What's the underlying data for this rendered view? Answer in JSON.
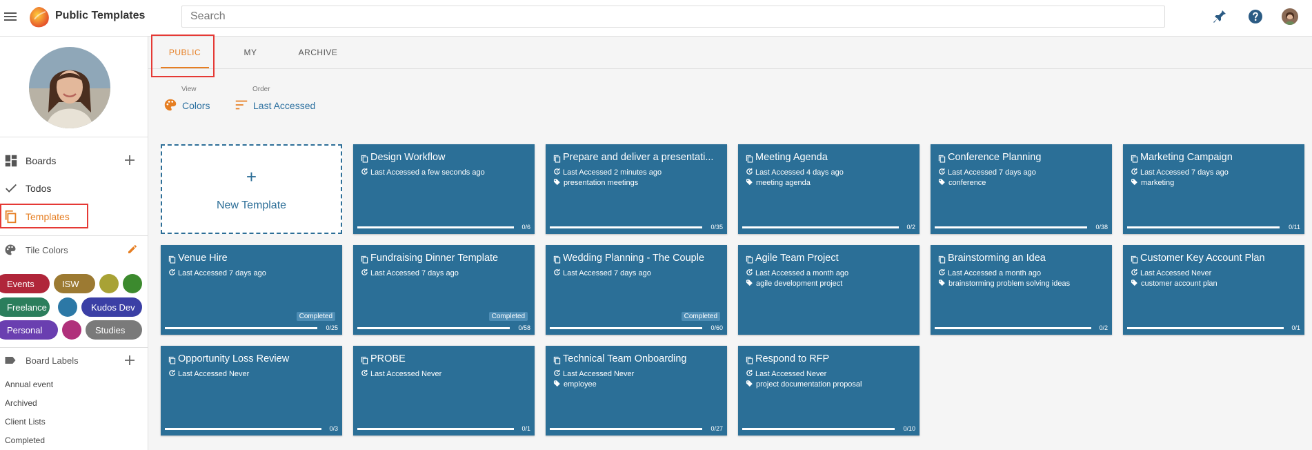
{
  "app": {
    "title": "Public Templates"
  },
  "search": {
    "placeholder": "Search",
    "value": ""
  },
  "tabs": [
    {
      "label": "PUBLIC",
      "active": true
    },
    {
      "label": "MY",
      "active": false
    },
    {
      "label": "ARCHIVE",
      "active": false
    }
  ],
  "view": {
    "label": "View",
    "value": "Colors"
  },
  "order": {
    "label": "Order",
    "value": "Last Accessed"
  },
  "sidebar": {
    "nav": [
      {
        "label": "Boards",
        "icon": "dashboard-icon"
      },
      {
        "label": "Todos",
        "icon": "check-icon"
      },
      {
        "label": "Templates",
        "icon": "copy-icon"
      }
    ],
    "tile_colors_title": "Tile Colors",
    "chips": [
      {
        "label": "Events",
        "color": "#b0263a"
      },
      {
        "label": "ISW",
        "color": "#9c7a32"
      },
      {
        "label": "",
        "color": "#a8a235"
      },
      {
        "label": "",
        "color": "#3c8a2e"
      },
      {
        "label": "Freelance",
        "color": "#2b7e5c"
      },
      {
        "label": "",
        "color": "#2c78a6"
      },
      {
        "label": "Kudos Dev",
        "color": "#3b3fa5"
      },
      {
        "label": "Personal",
        "color": "#6a3fb0"
      },
      {
        "label": "",
        "color": "#b0317b"
      },
      {
        "label": "Studies",
        "color": "#7a7a7a"
      }
    ],
    "board_labels_title": "Board Labels",
    "labels": [
      "Annual event",
      "Archived",
      "Client Lists",
      "Completed"
    ]
  },
  "new_template": {
    "label": "New Template"
  },
  "tiles": [
    {
      "title": "Design Workflow",
      "accessed": "Last Accessed a few seconds ago",
      "tags": "",
      "count": "0/6",
      "progress": 0,
      "completed": ""
    },
    {
      "title": "Prepare and deliver a presentati...",
      "accessed": "Last Accessed 2 minutes ago",
      "tags": "presentation meetings",
      "count": "0/35",
      "progress": 0,
      "completed": ""
    },
    {
      "title": "Meeting Agenda",
      "accessed": "Last Accessed 4 days ago",
      "tags": "meeting agenda",
      "count": "0/2",
      "progress": 0,
      "completed": ""
    },
    {
      "title": "Conference Planning",
      "accessed": "Last Accessed 7 days ago",
      "tags": "conference",
      "count": "0/38",
      "progress": 0,
      "completed": ""
    },
    {
      "title": "Marketing Campaign",
      "accessed": "Last Accessed 7 days ago",
      "tags": "marketing",
      "count": "0/11",
      "progress": 0,
      "completed": ""
    },
    {
      "title": "Venue Hire",
      "accessed": "Last Accessed 7 days ago",
      "tags": "",
      "count": "0/25",
      "progress": 0,
      "completed": "Completed"
    },
    {
      "title": "Fundraising Dinner Template",
      "accessed": "Last Accessed 7 days ago",
      "tags": "",
      "count": "0/58",
      "progress": 0,
      "completed": "Completed"
    },
    {
      "title": "Wedding Planning - The Couple",
      "accessed": "Last Accessed 7 days ago",
      "tags": "",
      "count": "0/60",
      "progress": 0,
      "completed": "Completed"
    },
    {
      "title": "Agile Team Project",
      "accessed": "Last Accessed a month ago",
      "tags": "agile development project",
      "count": "",
      "progress": null,
      "completed": ""
    },
    {
      "title": "Brainstorming an Idea",
      "accessed": "Last Accessed a month ago",
      "tags": "brainstorming problem solving ideas",
      "count": "0/2",
      "progress": 0,
      "completed": ""
    },
    {
      "title": "Customer Key Account Plan",
      "accessed": "Last Accessed Never",
      "tags": "customer account plan",
      "count": "0/1",
      "progress": 0,
      "completed": ""
    },
    {
      "title": "Opportunity Loss Review",
      "accessed": "Last Accessed Never",
      "tags": "",
      "count": "0/3",
      "progress": 0,
      "completed": ""
    },
    {
      "title": "PROBE",
      "accessed": "Last Accessed Never",
      "tags": "",
      "count": "0/1",
      "progress": 0,
      "completed": ""
    },
    {
      "title": "Technical Team Onboarding",
      "accessed": "Last Accessed Never",
      "tags": "employee",
      "count": "0/27",
      "progress": 0,
      "completed": ""
    },
    {
      "title": "Respond to RFP",
      "accessed": "Last Accessed Never",
      "tags": "project documentation proposal",
      "count": "0/10",
      "progress": 0,
      "completed": ""
    }
  ],
  "colors": {
    "accent": "#e67e22",
    "tile": "#2b6f97",
    "link": "#2a6f9f",
    "highlight": "#e53935"
  }
}
